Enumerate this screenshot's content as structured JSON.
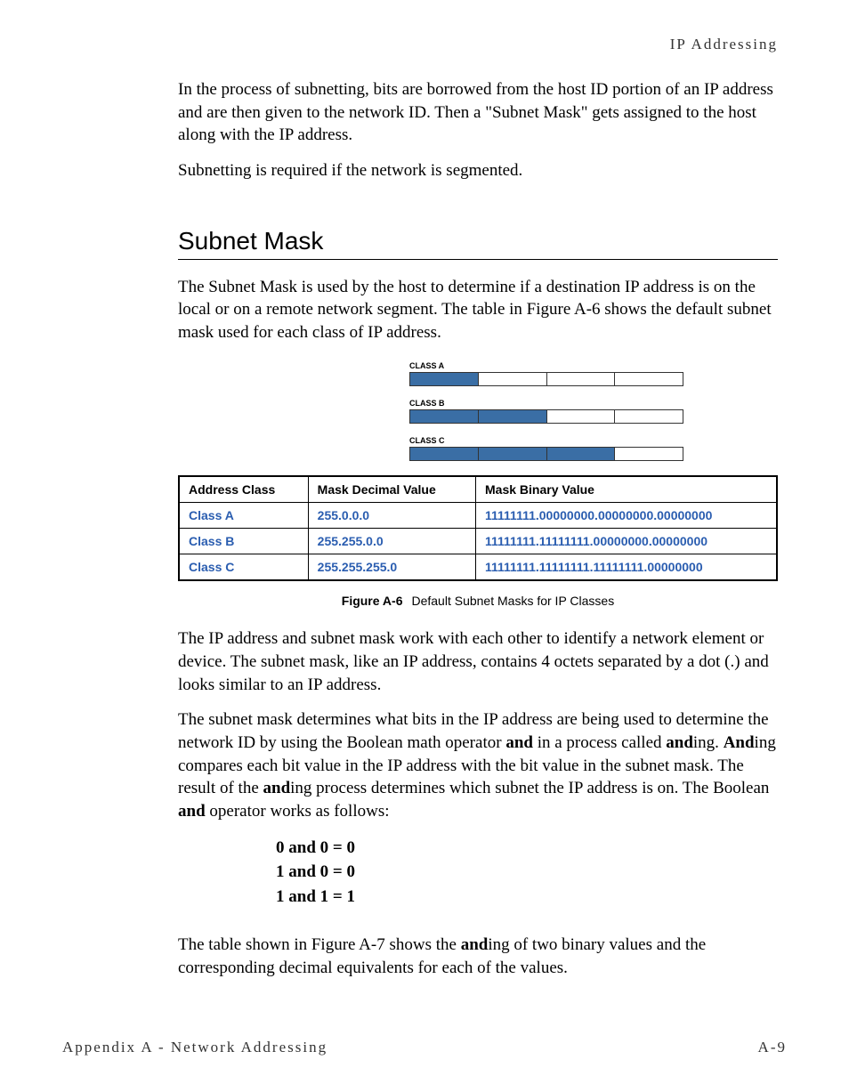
{
  "header": {
    "section_label": "IP Addressing"
  },
  "intro": {
    "p1": "In the process of subnetting, bits are borrowed from the host ID portion of an IP address and are then given to the network ID. Then a \"Subnet Mask\" gets assigned to the host along with the IP address.",
    "p2": "Subnetting is required if the network is segmented."
  },
  "section": {
    "title": "Subnet Mask",
    "p1": "The Subnet Mask is used by the host to determine if a destination IP address is on the local or on a remote network segment. The table in Figure A-6 shows the default subnet mask used for each class of IP address."
  },
  "diagram": {
    "classA": {
      "label": "CLASS A",
      "filled": 1,
      "total": 4
    },
    "classB": {
      "label": "CLASS B",
      "filled": 2,
      "total": 4
    },
    "classC": {
      "label": "CLASS C",
      "filled": 3,
      "total": 4
    }
  },
  "table": {
    "headers": {
      "c0": "Address Class",
      "c1": "Mask Decimal Value",
      "c2": "Mask Binary Value"
    },
    "rows": [
      {
        "c0": "Class A",
        "c1": "255.0.0.0",
        "c2": "11111111.00000000.00000000.00000000"
      },
      {
        "c0": "Class B",
        "c1": "255.255.0.0",
        "c2": "11111111.11111111.00000000.00000000"
      },
      {
        "c0": "Class C",
        "c1": "255.255.255.0",
        "c2": "11111111.11111111.11111111.00000000"
      }
    ]
  },
  "figure": {
    "label": "Figure A-6",
    "caption": "Default Subnet Masks for IP Classes"
  },
  "after_table": {
    "p1": "The IP address and subnet mask work with each other to identify a network element or device. The subnet mask, like an IP address, contains 4 octets separated by a dot (.) and looks similar to an IP address.",
    "p2_pre": "The subnet mask determines what bits in the IP address are being used to determine the network ID by using the Boolean math operator ",
    "and1": "and",
    "p2_mid1": " in a process called ",
    "and2": "and",
    "p2_mid2": "ing. ",
    "and3": "And",
    "p2_mid3": "ing compares each bit value in the IP address with the bit value in the subnet mask. The result of the ",
    "and4": "and",
    "p2_mid4": "ing process determines which subnet the IP address is on. The Boolean ",
    "and5": "and",
    "p2_end": " operator works as follows:"
  },
  "boolean": {
    "l1": "0 and 0 = 0",
    "l2": "1 and 0 = 0",
    "l3": "1 and 1 = 1"
  },
  "closing": {
    "pre": "The table shown in Figure A-7 shows the ",
    "and": "and",
    "post": "ing of two binary values and the corresponding decimal equivalents for each of the values."
  },
  "footer": {
    "left": "Appendix A - Network Addressing",
    "right": "A-9"
  }
}
